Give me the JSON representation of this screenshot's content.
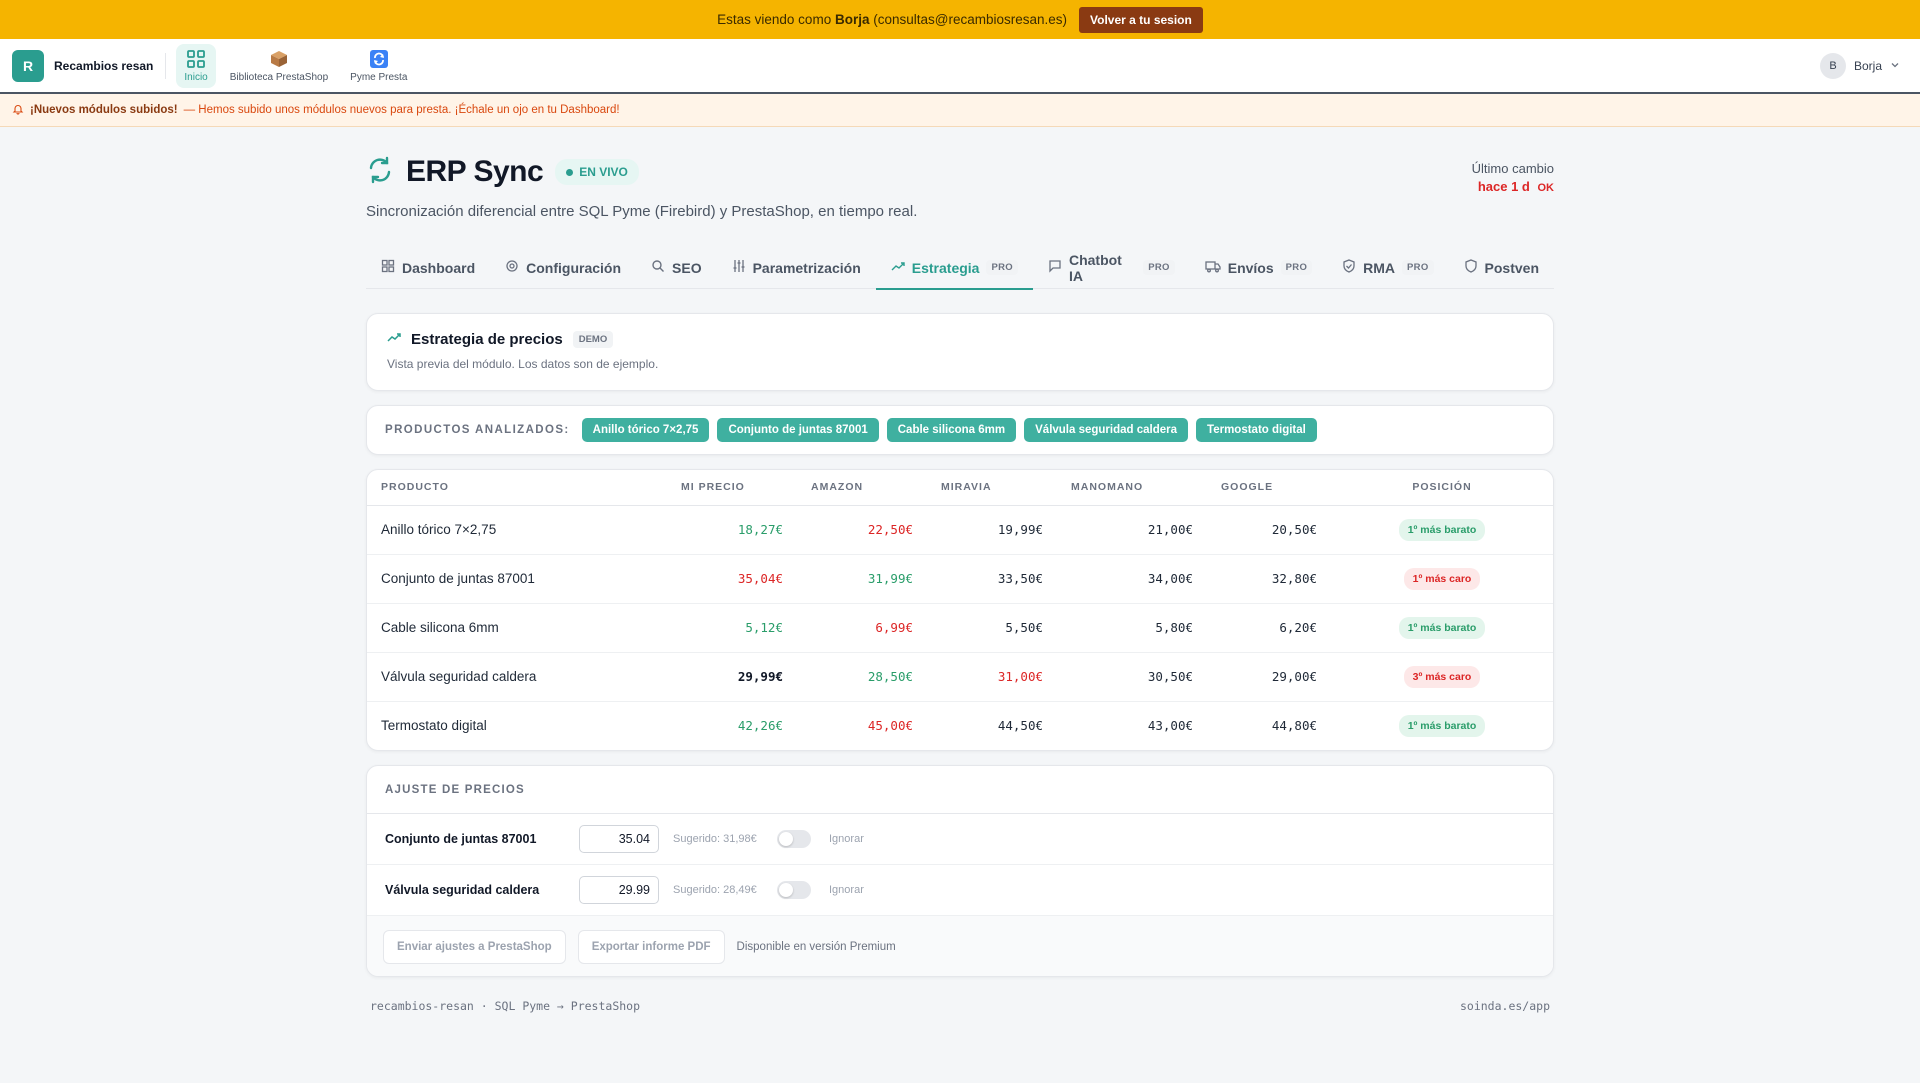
{
  "impersonation": {
    "prefix": "Estas viendo como",
    "user_name": "Borja",
    "user_email": "(consultas@recambiosresan.es)",
    "back_button": "Volver a tu sesion"
  },
  "topnav": {
    "brand_initial": "R",
    "brand_name": "Recambios resan",
    "items": [
      {
        "label": "Inicio",
        "icon": "grid-icon"
      },
      {
        "label": "Biblioteca PrestaShop",
        "icon": "package-icon"
      },
      {
        "label": "Pyme Presta",
        "icon": "sync-app-icon"
      }
    ],
    "user_initial": "B",
    "user_name": "Borja"
  },
  "notice": {
    "title": "¡Nuevos módulos subidos!",
    "text": "— Hemos subido unos módulos nuevos para presta. ¡Échale un ojo en tu Dashboard!"
  },
  "header": {
    "title": "ERP Sync",
    "live_badge": "EN VIVO",
    "subtitle": "Sincronización diferencial entre SQL Pyme (Firebird) y PrestaShop, en tiempo real.",
    "last_change_label": "Último cambio",
    "last_change_value": "hace 1 d",
    "last_change_status": "OK"
  },
  "tabs": [
    {
      "label": "Dashboard",
      "pro": ""
    },
    {
      "label": "Configuración",
      "pro": ""
    },
    {
      "label": "SEO",
      "pro": ""
    },
    {
      "label": "Parametrización",
      "pro": ""
    },
    {
      "label": "Estrategia",
      "pro": "PRO"
    },
    {
      "label": "Chatbot IA",
      "pro": "PRO"
    },
    {
      "label": "Envíos",
      "pro": "PRO"
    },
    {
      "label": "RMA",
      "pro": "PRO"
    },
    {
      "label": "Postven",
      "pro": ""
    }
  ],
  "strategy": {
    "title": "Estrategia de precios",
    "badge": "DEMO",
    "subtitle": "Vista previa del módulo. Los datos son de ejemplo."
  },
  "products": {
    "label": "PRODUCTOS ANALIZADOS:",
    "chips": [
      "Anillo tórico 7×2,75",
      "Conjunto de juntas 87001",
      "Cable silicona 6mm",
      "Válvula seguridad caldera",
      "Termostato digital"
    ]
  },
  "table": {
    "headers": [
      "PRODUCTO",
      "MI PRECIO",
      "AMAZON",
      "MIRAVIA",
      "MANOMANO",
      "GOOGLE",
      "POSICIÓN"
    ],
    "rows": [
      {
        "product": "Anillo tórico 7×2,75",
        "mine": "18,27€",
        "amazon": "22,50€",
        "miravia": "19,99€",
        "manomano": "21,00€",
        "google": "20,50€",
        "position": "1º más barato"
      },
      {
        "product": "Conjunto de juntas 87001",
        "mine": "35,04€",
        "amazon": "31,99€",
        "miravia": "33,50€",
        "manomano": "34,00€",
        "google": "32,80€",
        "position": "1º más caro"
      },
      {
        "product": "Cable silicona 6mm",
        "mine": "5,12€",
        "amazon": "6,99€",
        "miravia": "5,50€",
        "manomano": "5,80€",
        "google": "6,20€",
        "position": "1º más barato"
      },
      {
        "product": "Válvula seguridad caldera",
        "mine": "29,99€",
        "amazon": "28,50€",
        "miravia": "31,00€",
        "manomano": "30,50€",
        "google": "29,00€",
        "position": "3º más caro"
      },
      {
        "product": "Termostato digital",
        "mine": "42,26€",
        "amazon": "45,00€",
        "miravia": "44,50€",
        "manomano": "43,00€",
        "google": "44,80€",
        "position": "1º más barato"
      }
    ]
  },
  "adjust": {
    "title": "AJUSTE DE PRECIOS",
    "rows": [
      {
        "product": "Conjunto de juntas 87001",
        "value": "35.04",
        "suggested": "Sugerido: 31,98€",
        "ignore": "Ignorar"
      },
      {
        "product": "Válvula seguridad caldera",
        "value": "29.99",
        "suggested": "Sugerido: 28,49€",
        "ignore": "Ignorar"
      }
    ],
    "send_button": "Enviar ajustes a PrestaShop",
    "export_button": "Exportar informe PDF",
    "premium_note": "Disponible en versión Premium"
  },
  "footer": {
    "left": "recambios-resan · SQL Pyme → PrestaShop",
    "right": "soinda.es/app"
  },
  "colors": {
    "accent": "#2a9d8f",
    "banner": "#f5b400",
    "green": "#2a9d6a",
    "red": "#dc2626"
  }
}
